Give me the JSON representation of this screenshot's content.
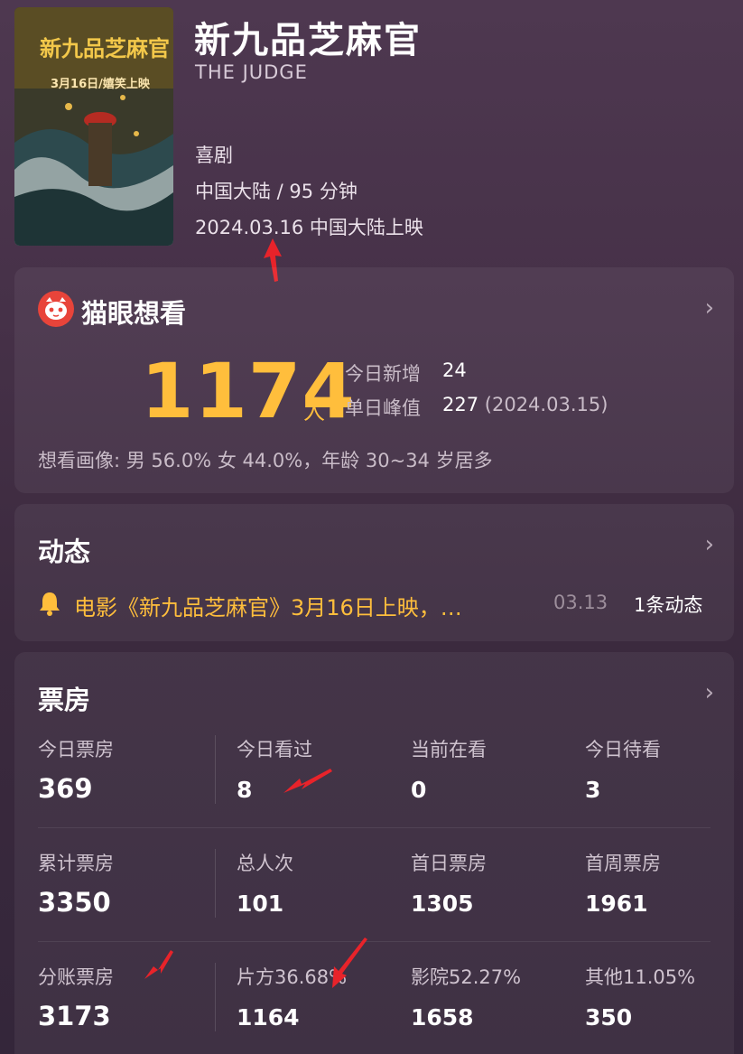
{
  "movie": {
    "title": "新九品芝麻官",
    "english_title": "THE JUDGE",
    "genre": "喜剧",
    "region_duration": "中国大陆 / 95 分钟",
    "release": "2024.03.16 中国大陆上映"
  },
  "poster": {
    "title_text": "新九品芝麻官",
    "date_text": "3月16日/嬉笑上映"
  },
  "want": {
    "header": "猫眼想看",
    "count": "1174",
    "unit": "人",
    "today_new_label": "今日新增",
    "today_new_value": "24",
    "peak_label": "单日峰值",
    "peak_value": "227",
    "peak_date": "(2024.03.15)",
    "profile": "想看画像: 男 56.0%  女 44.0%，年龄 30~34 岁居多"
  },
  "news": {
    "header": "动态",
    "text": "电影《新九品芝麻官》3月16日上映，…",
    "date": "03.13",
    "count": "1条动态"
  },
  "box_office": {
    "header": "票房",
    "rows": [
      [
        {
          "label": "今日票房",
          "value": "369"
        },
        {
          "label": "今日看过",
          "value": "8"
        },
        {
          "label": "当前在看",
          "value": "0"
        },
        {
          "label": "今日待看",
          "value": "3"
        }
      ],
      [
        {
          "label": "累计票房",
          "value": "3350"
        },
        {
          "label": "总人次",
          "value": "101"
        },
        {
          "label": "首日票房",
          "value": "1305"
        },
        {
          "label": "首周票房",
          "value": "1961"
        }
      ],
      [
        {
          "label": "分账票房",
          "value": "3173"
        },
        {
          "label": "片方36.68%",
          "value": "1164"
        },
        {
          "label": "影院52.27%",
          "value": "1658"
        },
        {
          "label": "其他11.05%",
          "value": "350"
        }
      ]
    ]
  },
  "colors": {
    "accent": "#ffbe3c",
    "brand_red": "#e8443a",
    "annotation_arrow": "#e8232a"
  },
  "icons": {
    "chevron": "chevron-right-icon",
    "cat": "maoyan-cat-logo-icon",
    "bell": "bell-icon",
    "arrow": "annotation-arrow-icon"
  }
}
